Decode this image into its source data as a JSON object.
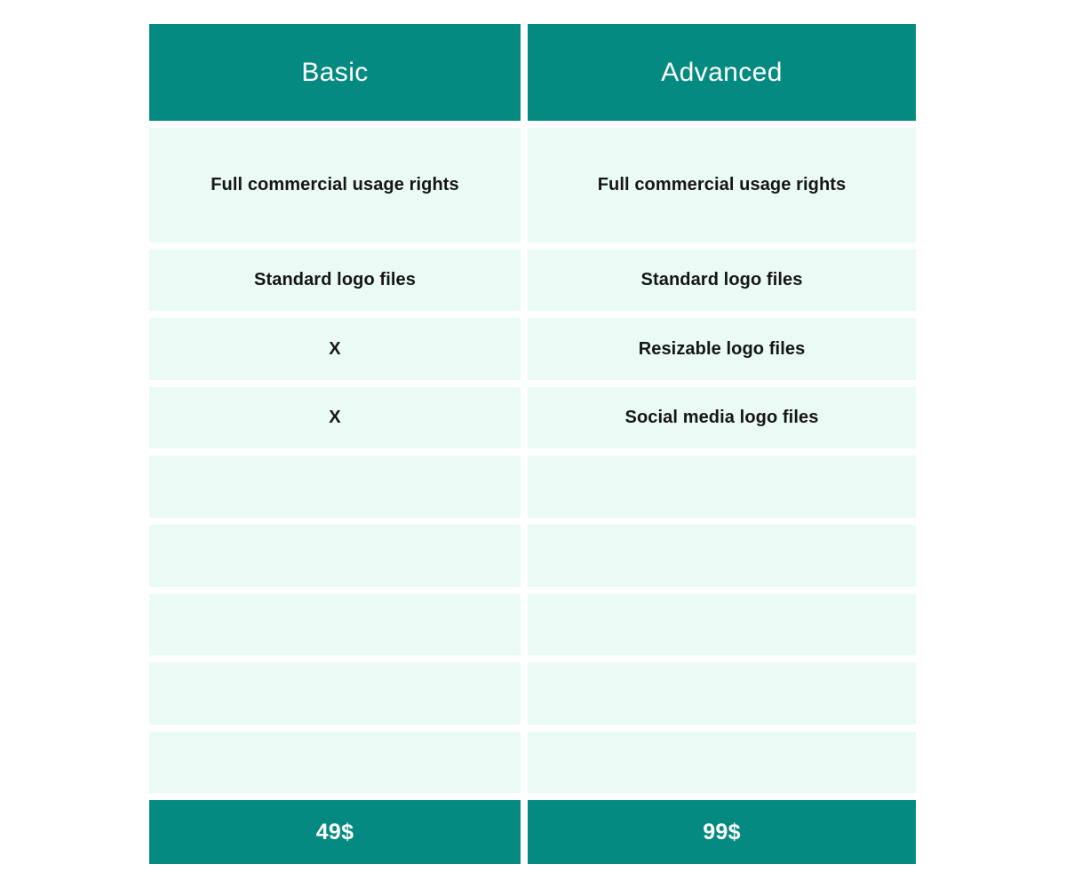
{
  "theme": {
    "accent_teal": "#048a80",
    "cell_mint": "#eafaf4",
    "text_dark": "#151515",
    "header_text": "#ffffff",
    "page_background": "#ffffff"
  },
  "table": {
    "columns": [
      {
        "id": "basic",
        "header": "Basic",
        "price": "49$",
        "features": [
          "Full commercial usage rights",
          "Standard logo files",
          "X",
          "X",
          "",
          "",
          "",
          "",
          ""
        ]
      },
      {
        "id": "advanced",
        "header": "Advanced",
        "price": "99$",
        "features": [
          "Full commercial usage rights",
          "Standard logo files",
          "Resizable logo files",
          "Social media logo files",
          "",
          "",
          "",
          "",
          ""
        ]
      }
    ]
  }
}
